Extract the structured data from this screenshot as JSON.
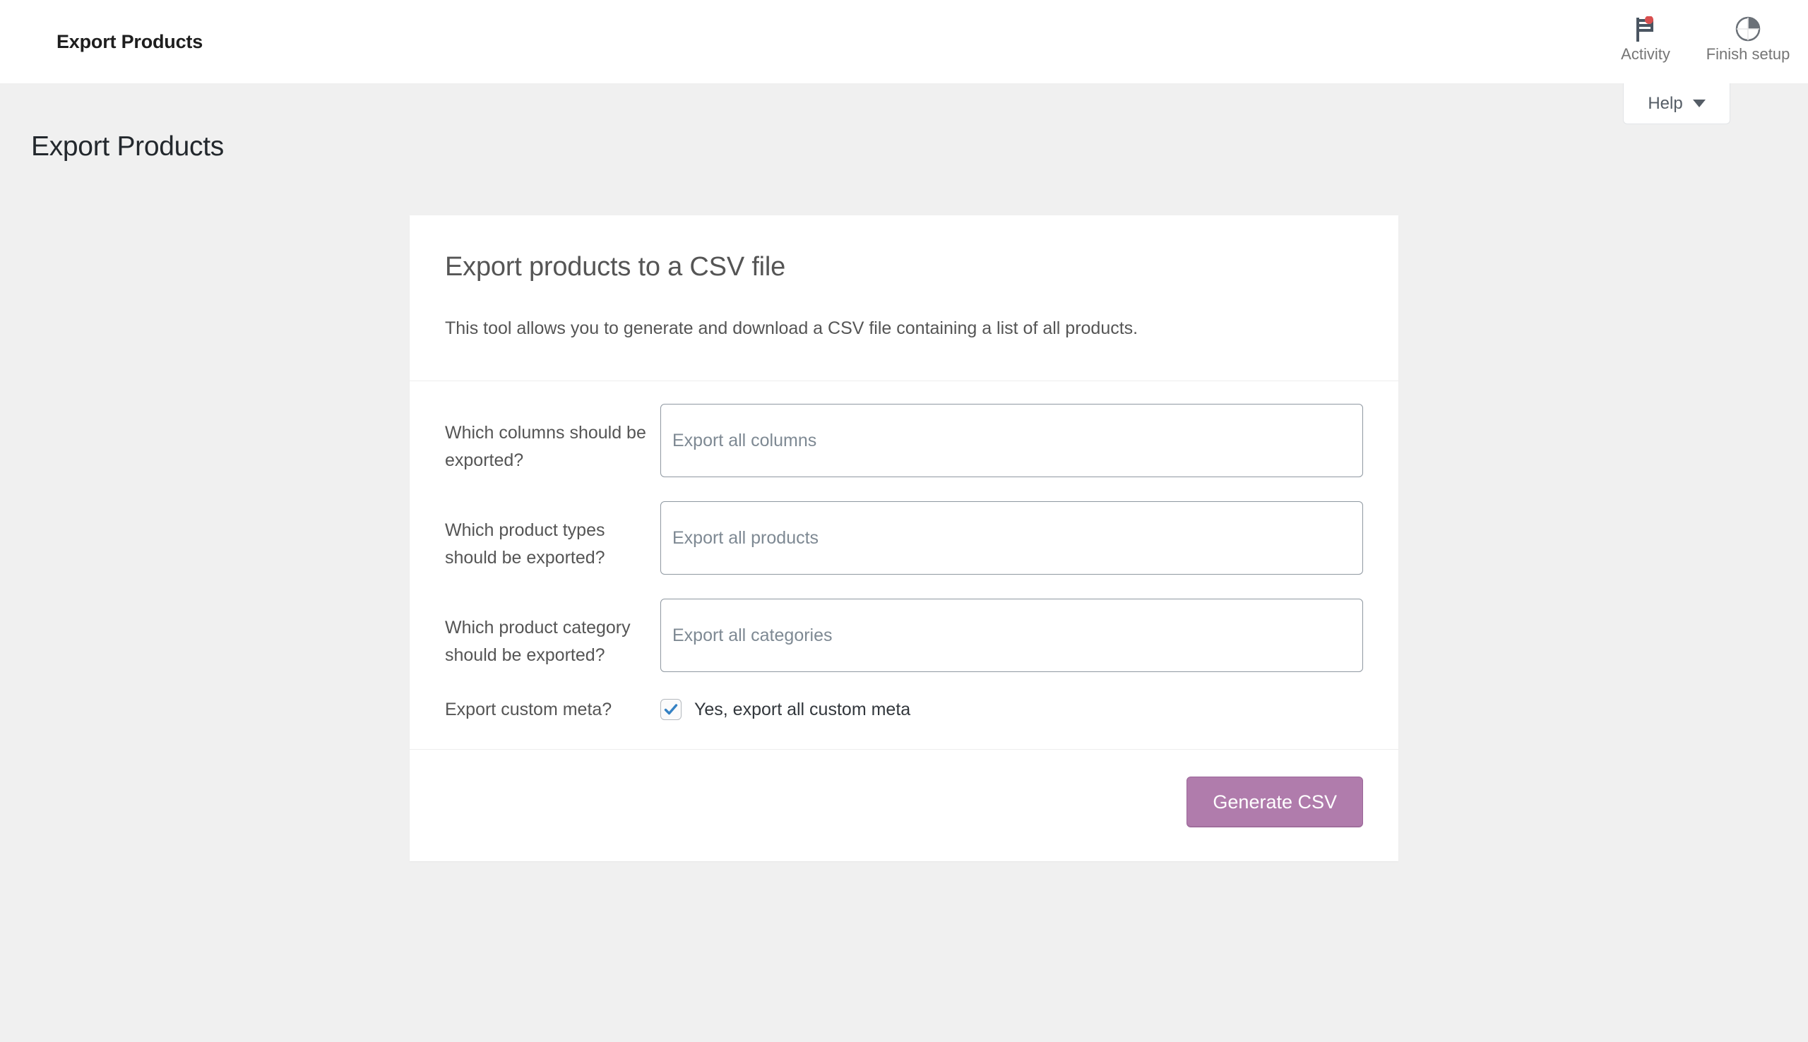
{
  "topbar": {
    "title": "Export Products",
    "items": [
      {
        "label": "Activity",
        "icon": "flag-icon",
        "badge": true
      },
      {
        "label": "Finish setup",
        "icon": "progress-circle-icon",
        "badge": false
      }
    ]
  },
  "help": {
    "label": "Help",
    "caret_icon": "chevron-down-icon"
  },
  "page": {
    "heading": "Export Products"
  },
  "card": {
    "title": "Export products to a CSV file",
    "description": "This tool allows you to generate and download a CSV file containing a list of all products.",
    "fields": [
      {
        "label": "Which columns should be exported?",
        "placeholder": "Export all columns"
      },
      {
        "label": "Which product types should be exported?",
        "placeholder": "Export all products"
      },
      {
        "label": "Which product category should be exported?",
        "placeholder": "Export all categories"
      }
    ],
    "custom_meta": {
      "label": "Export custom meta?",
      "checkbox_label": "Yes, export all custom meta",
      "checked": true
    },
    "submit_label": "Generate CSV"
  },
  "colors": {
    "page_background": "#f0f0f0",
    "card_background": "#ffffff",
    "primary_button": "#b07cac",
    "checkbox_check": "#3582c4",
    "badge_dot": "#d94f4f",
    "text_muted": "#757575"
  }
}
